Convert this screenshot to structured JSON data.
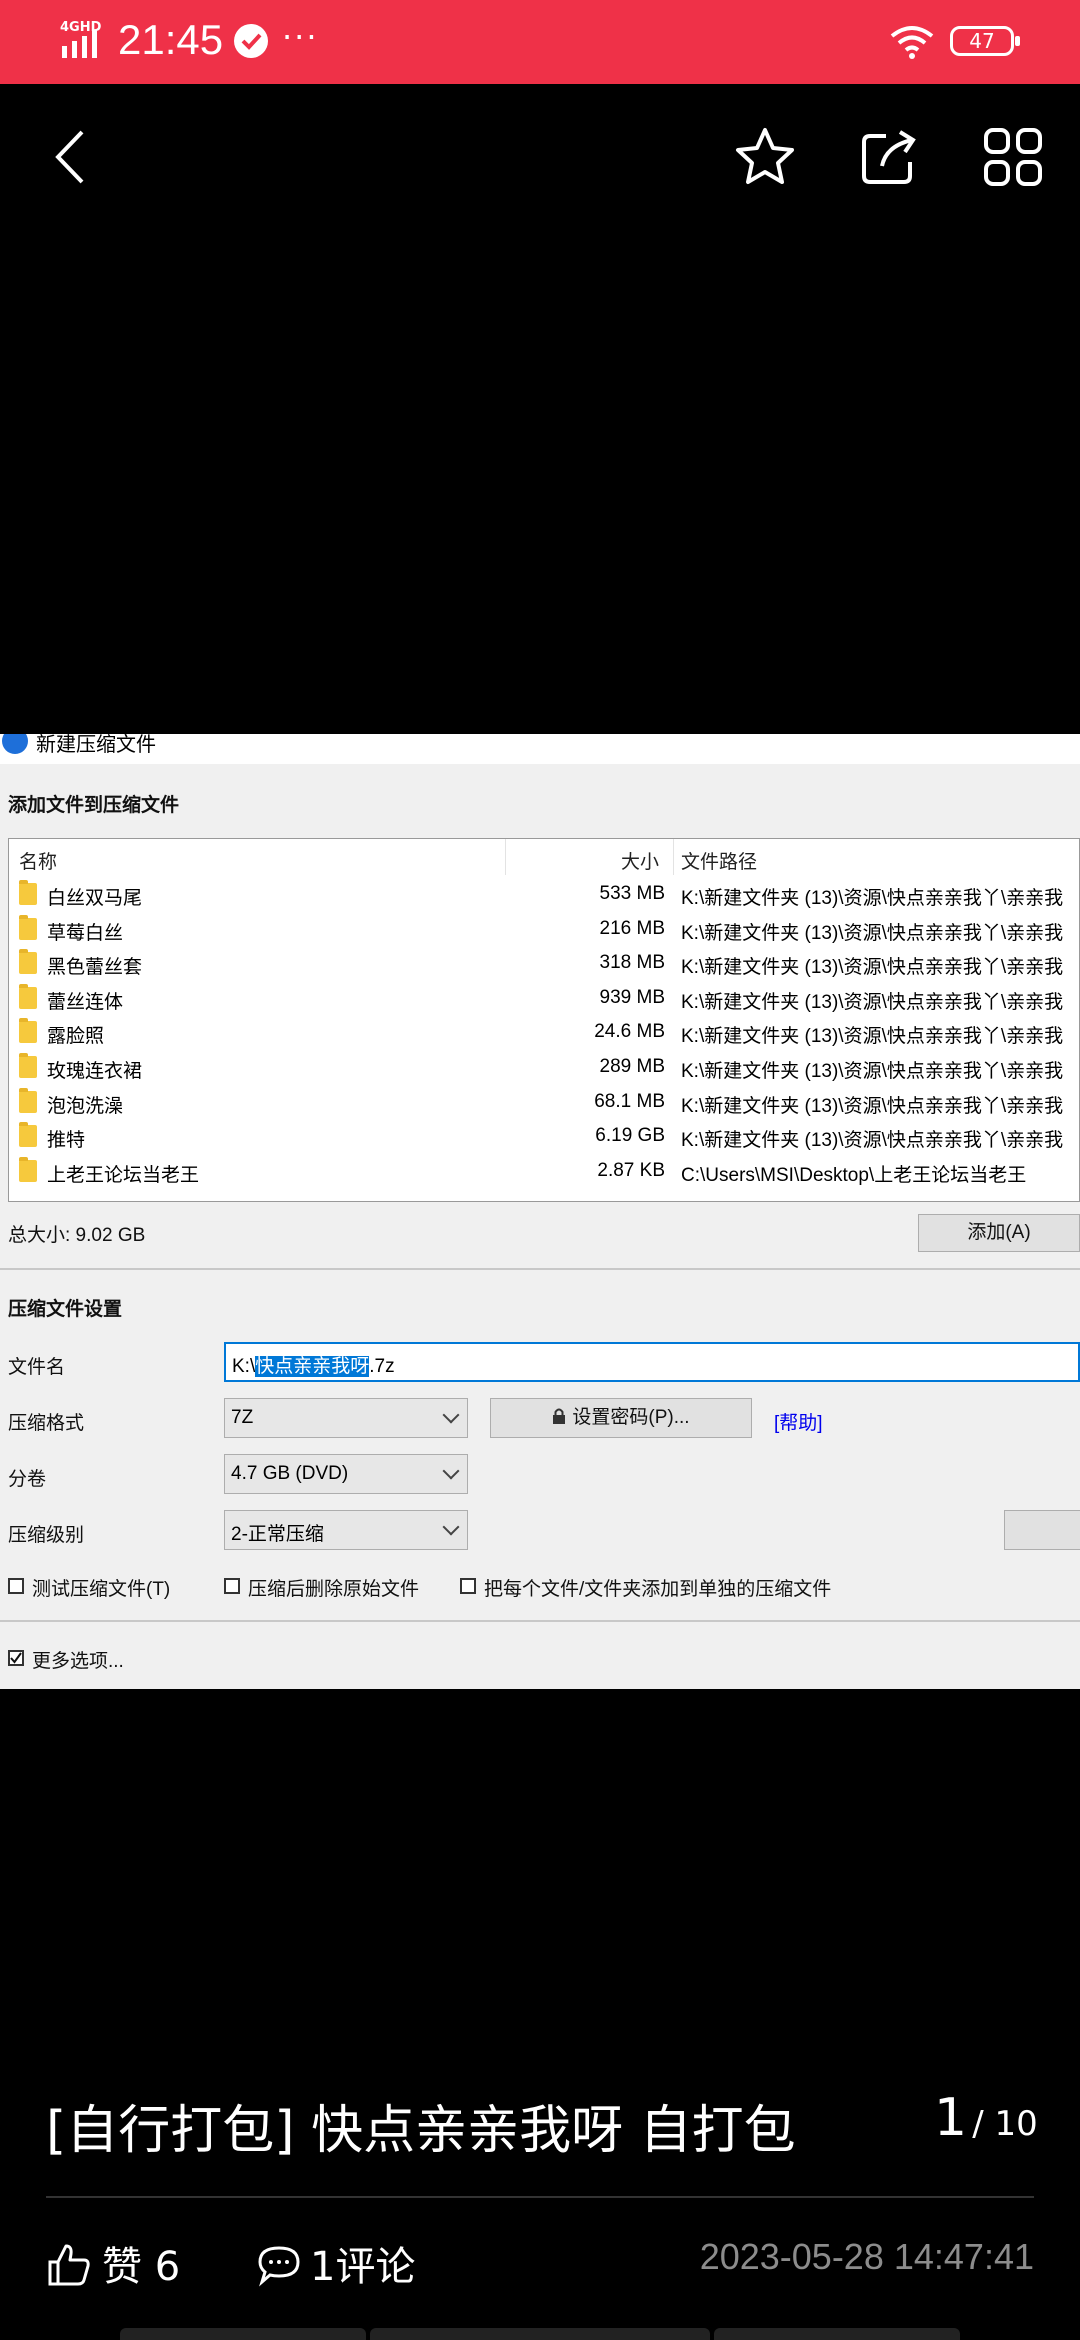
{
  "status_bar": {
    "network": "4GHD",
    "time": "21:45",
    "more": "···",
    "battery": "47"
  },
  "topbar": {
    "icons": [
      "back-icon",
      "star-icon",
      "share-icon",
      "grid-icon"
    ]
  },
  "window": {
    "title": "新建压缩文件",
    "add_section_title": "添加文件到压缩文件",
    "columns": [
      "名称",
      "大小",
      "文件路径"
    ],
    "files": [
      {
        "name": "白丝双马尾",
        "size": "533 MB",
        "path": "K:\\新建文件夹 (13)\\资源\\快点亲亲我丫\\亲亲我"
      },
      {
        "name": "草莓白丝",
        "size": "216 MB",
        "path": "K:\\新建文件夹 (13)\\资源\\快点亲亲我丫\\亲亲我"
      },
      {
        "name": "黑色蕾丝套",
        "size": "318 MB",
        "path": "K:\\新建文件夹 (13)\\资源\\快点亲亲我丫\\亲亲我"
      },
      {
        "name": "蕾丝连体",
        "size": "939 MB",
        "path": "K:\\新建文件夹 (13)\\资源\\快点亲亲我丫\\亲亲我"
      },
      {
        "name": "露脸照",
        "size": "24.6 MB",
        "path": "K:\\新建文件夹 (13)\\资源\\快点亲亲我丫\\亲亲我"
      },
      {
        "name": "玫瑰连衣裙",
        "size": "289 MB",
        "path": "K:\\新建文件夹 (13)\\资源\\快点亲亲我丫\\亲亲我"
      },
      {
        "name": "泡泡洗澡",
        "size": "68.1 MB",
        "path": "K:\\新建文件夹 (13)\\资源\\快点亲亲我丫\\亲亲我"
      },
      {
        "name": "推特",
        "size": "6.19 GB",
        "path": "K:\\新建文件夹 (13)\\资源\\快点亲亲我丫\\亲亲我"
      },
      {
        "name": "上老王论坛当老王",
        "size": "2.87 KB",
        "path": "C:\\Users\\MSI\\Desktop\\上老王论坛当老王"
      }
    ],
    "total_size": "总大小: 9.02 GB",
    "add_button": "添加(A)",
    "settings_title": "压缩文件设置",
    "filename_label": "文件名",
    "filename_prefix": "K:\\",
    "filename_selected": "快点亲亲我呀",
    "filename_suffix": ".7z",
    "format_label": "压缩格式",
    "format_value": "7Z",
    "password_button": "设置密码(P)...",
    "help_link": "[帮助]",
    "volume_label": "分卷",
    "volume_value": "4.7 GB (DVD)",
    "level_label": "压缩级别",
    "level_value": "2-正常压缩",
    "checkboxes": [
      {
        "label": "测试压缩文件(T)",
        "checked": false
      },
      {
        "label": "压缩后删除原始文件",
        "checked": false
      },
      {
        "label": "把每个文件/文件夹添加到单独的压缩文件",
        "checked": false
      }
    ],
    "more_options": {
      "label": "更多选项...",
      "checked": true
    }
  },
  "caption": "[自行打包] 快点亲亲我呀 自打包",
  "page": {
    "current": "1",
    "total": "/ 10"
  },
  "actions": {
    "like": "赞 6",
    "comment": "1评论",
    "timestamp": "2023-05-28 14:47:41"
  },
  "colors": {
    "status_bar": "#EF3148",
    "selection": "#0078D7",
    "help_link": "#0000EE"
  }
}
